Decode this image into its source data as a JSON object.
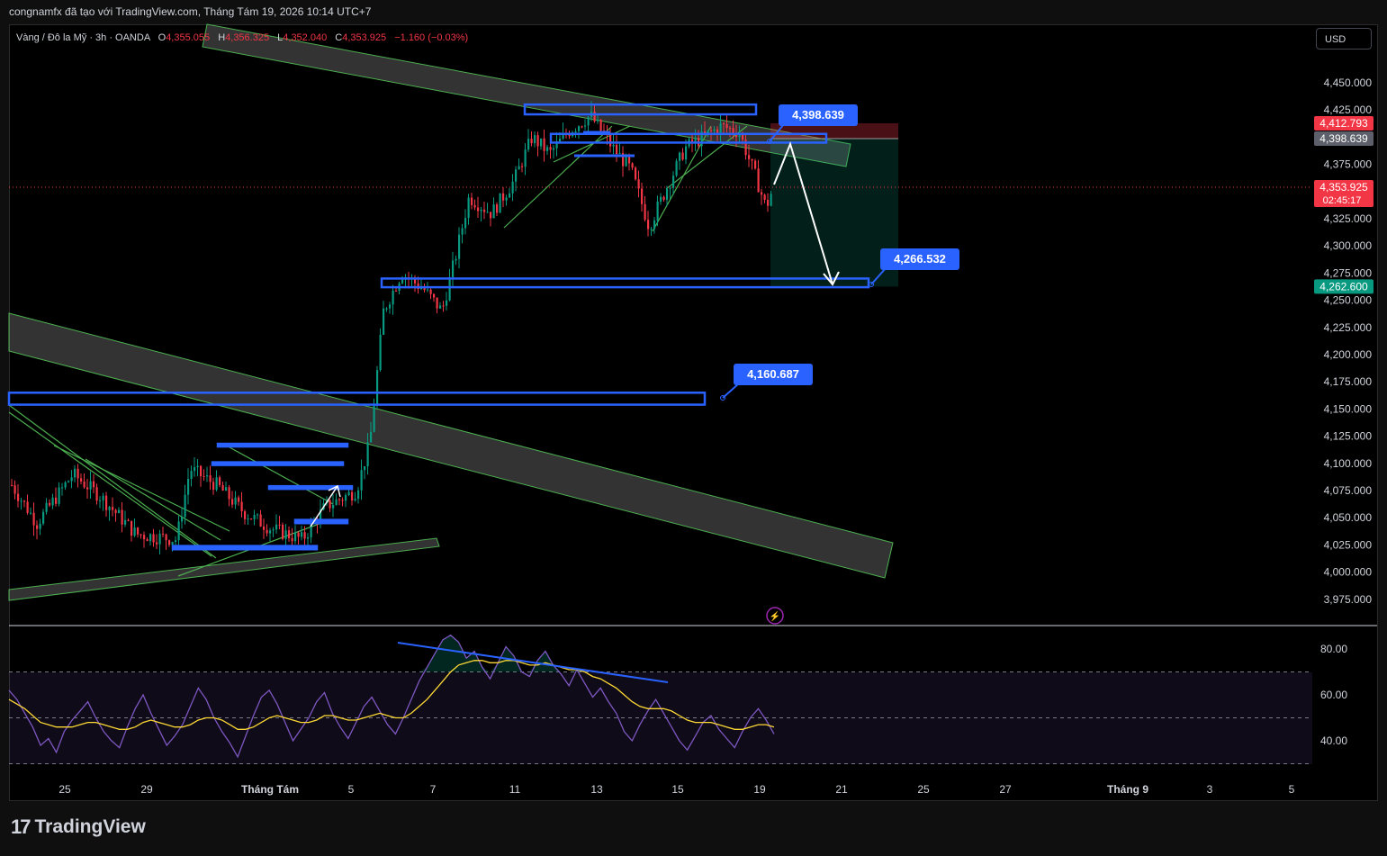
{
  "header": {
    "attribution": "congnamfx đã tạo với TradingView.com, Tháng Tám 19, 2026 10:14 UTC+7"
  },
  "symbol_bar": {
    "name": "Vàng / Đô la Mỹ · 3h · OANDA",
    "o_label": "O",
    "o_value": "4,355.055",
    "h_label": "H",
    "h_value": "4,356.325",
    "l_label": "L",
    "l_value": "4,352.040",
    "c_label": "C",
    "c_value": "4,353.925",
    "change": "−1.160 (−0.03%)"
  },
  "currency_button": "USD",
  "footer": {
    "brand_mark": "17",
    "brand_text": "TradingView"
  },
  "colors": {
    "up": "#089981",
    "down": "#f23645",
    "zone": "#2962ff",
    "channel": "#4caf50",
    "rsi": "#7e57c2",
    "rsi_ma": "#fdd835"
  },
  "chart_data": [
    {
      "type": "candlestick",
      "symbol": "Vàng / Đô la Mỹ",
      "timeframe": "3h",
      "broker": "OANDA",
      "x_ticks": [
        "25",
        "29",
        "Tháng Tám",
        "5",
        "7",
        "11",
        "13",
        "15",
        "19",
        "21",
        "25",
        "27",
        "Tháng 9",
        "3",
        "5"
      ],
      "y_ticks": [
        "4,450.000",
        "4,425.000",
        "4,375.000",
        "4,325.000",
        "4,300.000",
        "4,275.000",
        "4,250.000",
        "4,225.000",
        "4,200.000",
        "4,175.000",
        "4,150.000",
        "4,125.000",
        "4,100.000",
        "4,075.000",
        "4,050.000",
        "4,025.000",
        "4,000.000",
        "3,975.000"
      ],
      "ylim": [
        3960,
        4470
      ],
      "price_tags": [
        {
          "label": "4,412.793",
          "value": 4412.793,
          "color": "#f23645"
        },
        {
          "label": "4,398.639",
          "value": 4398.639,
          "color": "#5d606b"
        },
        {
          "label": "4,353.925",
          "sub": "02:45:17",
          "value": 4353.925,
          "color": "#f23645"
        },
        {
          "label": "4,262.600",
          "value": 4262.6,
          "color": "#089981"
        }
      ],
      "callouts": [
        {
          "label": "4,398.639",
          "value": 4398.639
        },
        {
          "label": "4,266.532",
          "value": 4266.532
        },
        {
          "label": "4,160.687",
          "value": 4160.687
        }
      ],
      "short_position": {
        "entry": 4398.639,
        "stop": 4412.793,
        "target": 4262.6
      },
      "zones": [
        {
          "top": 4430,
          "bottom": 4421
        },
        {
          "top": 4403,
          "bottom": 4395
        },
        {
          "top": 4270,
          "bottom": 4262
        },
        {
          "top": 4165,
          "bottom": 4154
        },
        {
          "top": 4118,
          "bottom": 4116
        },
        {
          "top": 4101,
          "bottom": 4099
        },
        {
          "top": 4079,
          "bottom": 4077
        },
        {
          "top": 4048,
          "bottom": 4045
        },
        {
          "top": 4024,
          "bottom": 4021
        }
      ],
      "current_price": 4353.925
    },
    {
      "type": "line",
      "name": "RSI",
      "y_ticks": [
        "80.00",
        "60.00",
        "40.00"
      ],
      "ylim": [
        30,
        90
      ],
      "bands": [
        70,
        50,
        30
      ],
      "series": [
        {
          "values": [
            62,
            58,
            52,
            46,
            38,
            41,
            35,
            44,
            49,
            53,
            57,
            50,
            44,
            40,
            37,
            46,
            54,
            60,
            52,
            45,
            38,
            42,
            47,
            55,
            63,
            58,
            50,
            44,
            39,
            33,
            42,
            51,
            59,
            62,
            56,
            48,
            40,
            45,
            50,
            57,
            61,
            52,
            46,
            41,
            48,
            55,
            59,
            53,
            47,
            43,
            50,
            58,
            66,
            72,
            78,
            84,
            86,
            83,
            76,
            79,
            72,
            67,
            74,
            81,
            77,
            70,
            68,
            75,
            79,
            73,
            69,
            64,
            71,
            65,
            59,
            63,
            57,
            52,
            44,
            40,
            47,
            53,
            58,
            52,
            46,
            40,
            36,
            42,
            48,
            51,
            45,
            41,
            37,
            44,
            50,
            54,
            49,
            43
          ]
        },
        {
          "values": [
            58,
            56,
            54,
            51,
            48,
            47,
            46,
            46,
            46,
            47,
            48,
            48,
            47,
            46,
            45,
            45,
            46,
            48,
            49,
            48,
            47,
            46,
            46,
            47,
            49,
            50,
            50,
            49,
            47,
            45,
            45,
            46,
            48,
            50,
            51,
            50,
            49,
            48,
            48,
            49,
            51,
            51,
            50,
            49,
            49,
            50,
            51,
            52,
            51,
            50,
            50,
            52,
            55,
            58,
            62,
            66,
            70,
            73,
            74,
            75,
            75,
            74,
            74,
            75,
            75,
            74,
            73,
            73,
            74,
            73,
            72,
            71,
            71,
            70,
            68,
            67,
            65,
            63,
            60,
            57,
            55,
            54,
            54,
            54,
            53,
            51,
            49,
            48,
            48,
            48,
            47,
            46,
            45,
            45,
            46,
            47,
            47,
            46
          ]
        }
      ]
    }
  ]
}
